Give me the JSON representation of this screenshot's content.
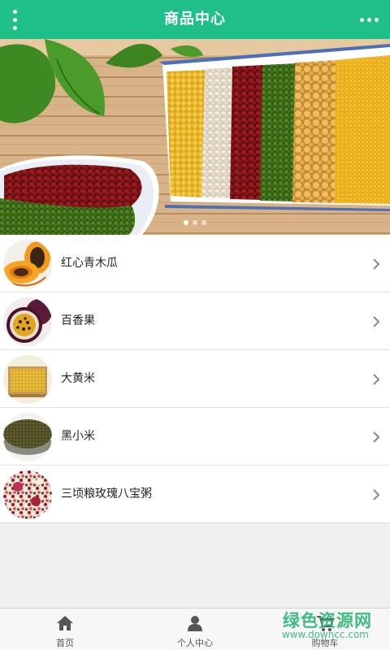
{
  "header": {
    "title": "商品中心"
  },
  "banner": {
    "slides": 3,
    "active_slide": 1
  },
  "products": [
    {
      "name": "红心青木瓜",
      "image": "papaya"
    },
    {
      "name": "百香果",
      "image": "passion-fruit"
    },
    {
      "name": "大黄米",
      "image": "yellow-millet"
    },
    {
      "name": "黑小米",
      "image": "black-millet"
    },
    {
      "name": "三顷粮玫瑰八宝粥",
      "image": "eight-treasure-congee"
    }
  ],
  "tabbar": {
    "home": "首页",
    "profile": "个人中心",
    "cart": "购物车"
  },
  "watermark": {
    "line1": "绿色资源网",
    "line2": "www.downcc.com"
  },
  "colors": {
    "header_bg": "#1fbf8a",
    "watermark": "#20b26e"
  }
}
